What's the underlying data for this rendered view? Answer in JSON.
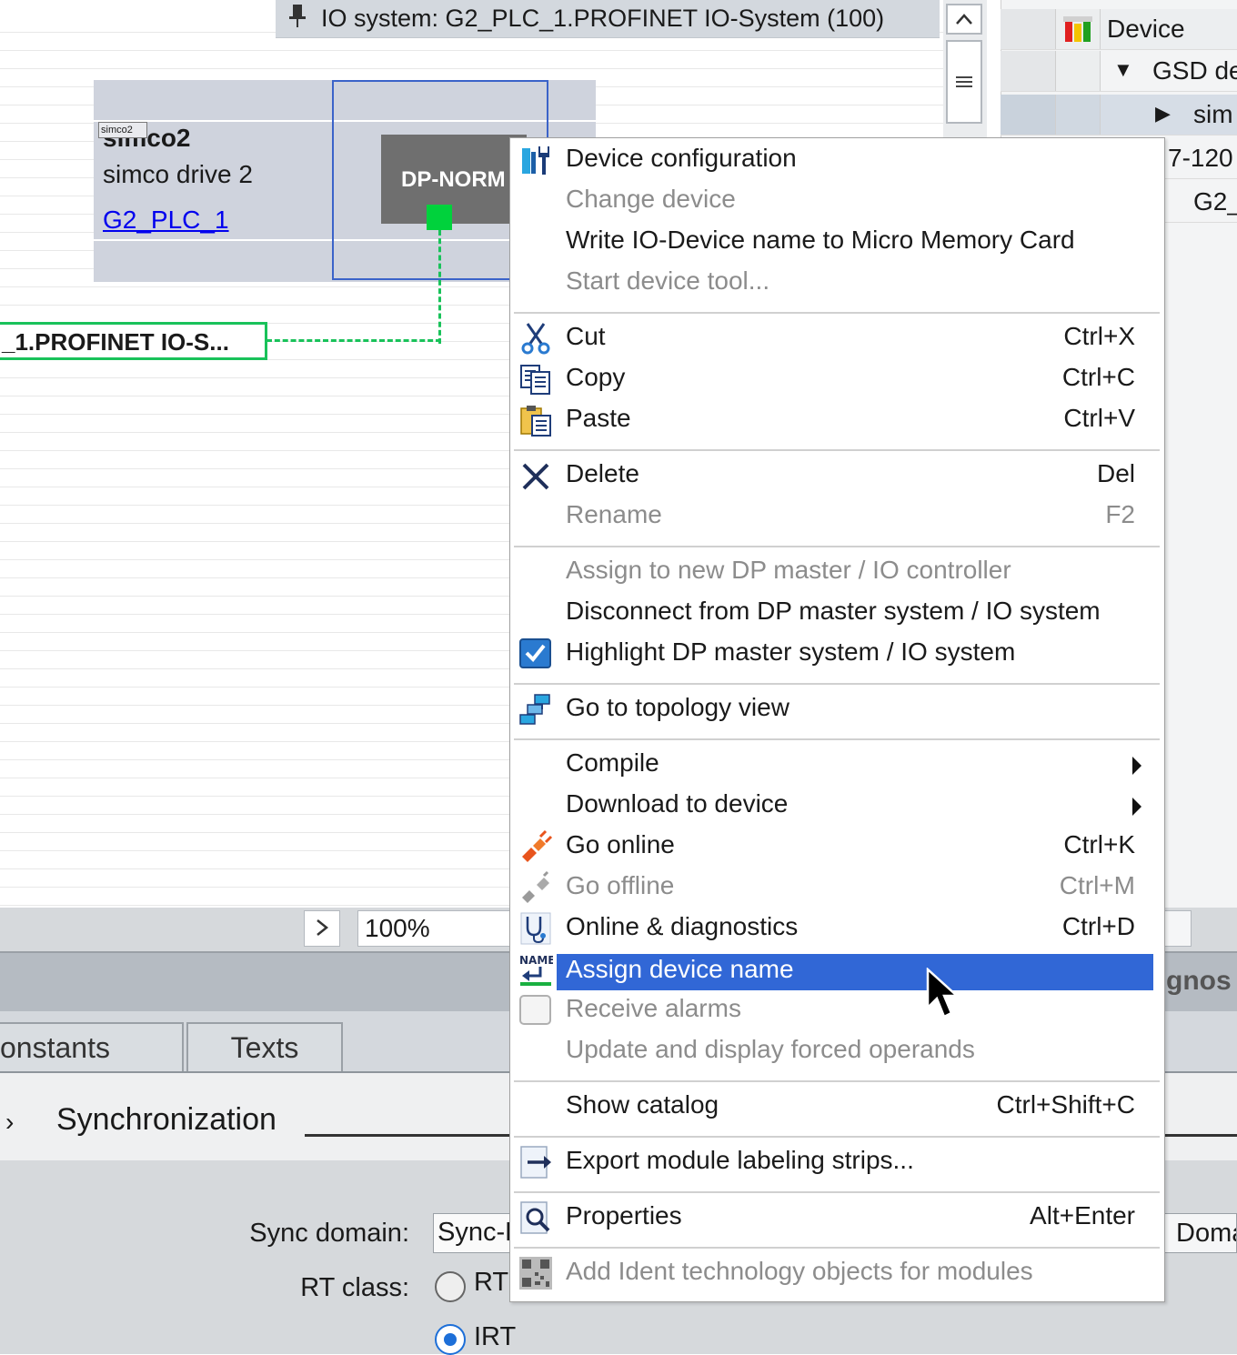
{
  "network_view": {
    "io_system_header": "IO system: G2_PLC_1.PROFINET IO-System (100)",
    "device": {
      "tag": "simco2",
      "name": "simco2",
      "type": "simco drive 2",
      "controller_link": "G2_PLC_1",
      "module_label": "DP-NORM"
    },
    "io_system_label": "_1.PROFINET  IO-S..."
  },
  "device_tree": {
    "header": "Device",
    "rows": [
      "GSD de",
      "sim",
      "7-120",
      "G2_"
    ]
  },
  "zoom": {
    "value": "100%"
  },
  "inspector": {
    "diagnostics_tab": "gnos",
    "tabs": [
      "onstants",
      "Texts"
    ],
    "section_title": "Synchronization",
    "sync_domain_label": "Sync domain:",
    "sync_domain_value": "Sync-D",
    "domain_button": "Doma",
    "rt_class_label": "RT class:",
    "rt_options": [
      {
        "label": "RT",
        "selected": false
      },
      {
        "label": "IRT",
        "selected": true
      }
    ]
  },
  "context_menu": {
    "highlight_color": "#3167d6",
    "items": [
      {
        "label": "Device configuration",
        "shortcut": "",
        "disabled": false,
        "icon": "device-config-icon"
      },
      {
        "label": "Change device",
        "shortcut": "",
        "disabled": true,
        "icon": ""
      },
      {
        "label": "Write IO-Device name to Micro Memory Card",
        "shortcut": "",
        "disabled": false,
        "icon": ""
      },
      {
        "label": "Start device tool...",
        "shortcut": "",
        "disabled": true,
        "icon": ""
      },
      {
        "label": "Cut",
        "shortcut": "Ctrl+X",
        "disabled": false,
        "icon": "scissors-icon"
      },
      {
        "label": "Copy",
        "shortcut": "Ctrl+C",
        "disabled": false,
        "icon": "copy-icon"
      },
      {
        "label": "Paste",
        "shortcut": "Ctrl+V",
        "disabled": false,
        "icon": "paste-icon"
      },
      {
        "label": "Delete",
        "shortcut": "Del",
        "disabled": false,
        "icon": "delete-x-icon"
      },
      {
        "label": "Rename",
        "shortcut": "F2",
        "disabled": true,
        "icon": ""
      },
      {
        "label": "Assign to new DP master / IO controller",
        "shortcut": "",
        "disabled": true,
        "icon": ""
      },
      {
        "label": "Disconnect from DP master system / IO system",
        "shortcut": "",
        "disabled": false,
        "icon": ""
      },
      {
        "label": "Highlight DP master system / IO system",
        "shortcut": "",
        "disabled": false,
        "icon": "checkbox-checked-icon"
      },
      {
        "label": "Go to topology view",
        "shortcut": "",
        "disabled": false,
        "icon": "topology-icon"
      },
      {
        "label": "Compile",
        "shortcut": "",
        "disabled": false,
        "icon": "",
        "submenu": true
      },
      {
        "label": "Download to device",
        "shortcut": "",
        "disabled": false,
        "icon": "",
        "submenu": true
      },
      {
        "label": "Go online",
        "shortcut": "Ctrl+K",
        "disabled": false,
        "icon": "go-online-plug-icon"
      },
      {
        "label": "Go offline",
        "shortcut": "Ctrl+M",
        "disabled": true,
        "icon": "go-offline-plug-icon"
      },
      {
        "label": "Online & diagnostics",
        "shortcut": "Ctrl+D",
        "disabled": false,
        "icon": "stethoscope-icon"
      },
      {
        "label": "Assign device name",
        "shortcut": "",
        "disabled": false,
        "highlighted": true,
        "icon": "name-assign-icon"
      },
      {
        "label": "Receive alarms",
        "shortcut": "",
        "disabled": true,
        "icon": "checkbox-empty-icon"
      },
      {
        "label": "Update and display forced operands",
        "shortcut": "",
        "disabled": true,
        "icon": ""
      },
      {
        "label": "Show catalog",
        "shortcut": "Ctrl+Shift+C",
        "disabled": false,
        "icon": ""
      },
      {
        "label": "Export module labeling strips...",
        "shortcut": "",
        "disabled": false,
        "icon": "export-arrow-icon"
      },
      {
        "label": "Properties",
        "shortcut": "Alt+Enter",
        "disabled": false,
        "icon": "properties-magnifier-icon"
      },
      {
        "label": "Add Ident technology objects for modules",
        "shortcut": "",
        "disabled": true,
        "icon": "qr-code-icon"
      }
    ]
  }
}
